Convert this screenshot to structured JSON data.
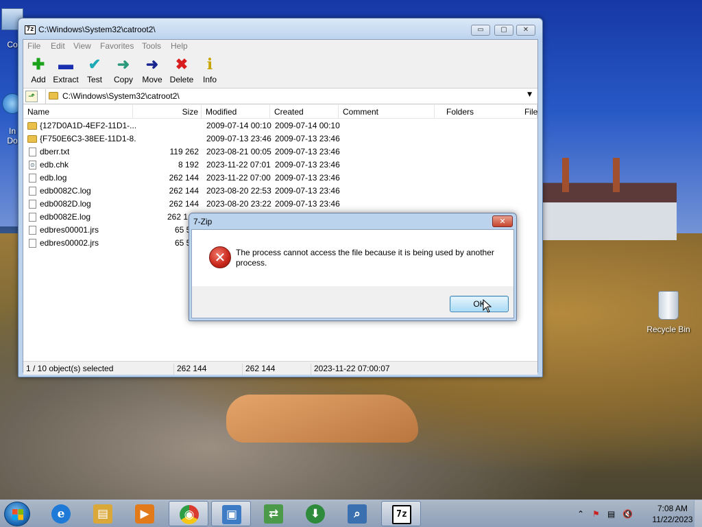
{
  "desktop": {
    "icons": [
      {
        "label": "Co",
        "icon": "computer-icon"
      },
      {
        "label": "In\nDo",
        "icon": "internet-explorer-icon"
      },
      {
        "label": "Recycle Bin",
        "icon": "recycle-bin-icon"
      }
    ]
  },
  "window": {
    "title": "C:\\Windows\\System32\\catroot2\\",
    "app_icon_label": "7z",
    "caption_buttons": {
      "minimize": "▭",
      "maximize": "▢",
      "close": "✕"
    },
    "menu": [
      "File",
      "Edit",
      "View",
      "Favorites",
      "Tools",
      "Help"
    ],
    "toolbar": [
      {
        "label": "Add",
        "icon": "add-plus-icon",
        "glyph": "✚",
        "color": "#1aa31a"
      },
      {
        "label": "Extract",
        "icon": "extract-minus-icon",
        "glyph": "▬",
        "color": "#1a2fb0"
      },
      {
        "label": "Test",
        "icon": "test-checkmark-icon",
        "glyph": "✔",
        "color": "#1ba9b5"
      },
      {
        "label": "Copy",
        "icon": "copy-arrow-icon",
        "glyph": "➜",
        "color": "#2a9a7a"
      },
      {
        "label": "Move",
        "icon": "move-arrow-icon",
        "glyph": "➜",
        "color": "#1a2690"
      },
      {
        "label": "Delete",
        "icon": "delete-x-icon",
        "glyph": "✖",
        "color": "#d81e1e"
      },
      {
        "label": "Info",
        "icon": "info-icon",
        "glyph": "i",
        "color": "#c8a400"
      }
    ],
    "address": "C:\\Windows\\System32\\catroot2\\",
    "columns": [
      "Name",
      "Size",
      "Modified",
      "Created",
      "Comment",
      "Folders",
      "File"
    ],
    "rows": [
      {
        "name": "{127D0A1D-4EF2-11D1-...",
        "size": "",
        "modified": "2009-07-14 00:10",
        "created": "2009-07-14 00:10",
        "type": "folder"
      },
      {
        "name": "{F750E6C3-38EE-11D1-8...",
        "size": "",
        "modified": "2009-07-13 23:46",
        "created": "2009-07-13 23:46",
        "type": "folder"
      },
      {
        "name": "dberr.txt",
        "size": "119 262",
        "modified": "2023-08-21 00:05",
        "created": "2009-07-13 23:46",
        "type": "file"
      },
      {
        "name": "edb.chk",
        "size": "8 192",
        "modified": "2023-11-22 07:01",
        "created": "2009-07-13 23:46",
        "type": "chk"
      },
      {
        "name": "edb.log",
        "size": "262 144",
        "modified": "2023-11-22 07:00",
        "created": "2009-07-13 23:46",
        "type": "file"
      },
      {
        "name": "edb0082C.log",
        "size": "262 144",
        "modified": "2023-08-20 22:53",
        "created": "2009-07-13 23:46",
        "type": "file"
      },
      {
        "name": "edb0082D.log",
        "size": "262 144",
        "modified": "2023-08-20 23:22",
        "created": "2009-07-13 23:46",
        "type": "file"
      },
      {
        "name": "edb0082E.log",
        "size": "262 1",
        "modified": "",
        "created": "",
        "type": "file"
      },
      {
        "name": "edbres00001.jrs",
        "size": "65 5",
        "modified": "",
        "created": "",
        "type": "file"
      },
      {
        "name": "edbres00002.jrs",
        "size": "65 5",
        "modified": "",
        "created": "",
        "type": "file"
      }
    ],
    "status": {
      "selection": "1 / 10 object(s) selected",
      "size": "262 144",
      "packed": "262 144",
      "date": "2023-11-22 07:00:07"
    },
    "scroll_grip": "|||"
  },
  "dialog": {
    "title": "7-Zip",
    "close_glyph": "✕",
    "error_glyph": "✕",
    "message": "The process cannot access the file because it is being used by another process.",
    "ok_label": "OK"
  },
  "taskbar": {
    "apps": [
      {
        "name": "internet-explorer",
        "glyph": "e",
        "color": "#1e7ad6",
        "active": false
      },
      {
        "name": "file-explorer",
        "glyph": "▤",
        "color": "#d9a838",
        "active": false
      },
      {
        "name": "media-player",
        "glyph": "▶",
        "color": "#e27a1a",
        "active": false
      },
      {
        "name": "chrome",
        "glyph": "◉",
        "color": "#d93b2f",
        "active": true
      },
      {
        "name": "remote-desktop",
        "glyph": "▣",
        "color": "#3d7bc4",
        "active": true
      },
      {
        "name": "network-tool",
        "glyph": "⇄",
        "color": "#4a9a4a",
        "active": false
      },
      {
        "name": "download-manager",
        "glyph": "⬇",
        "color": "#2e8b3c",
        "active": false
      },
      {
        "name": "search-tool",
        "glyph": "⌕",
        "color": "#3a6fb0",
        "active": false
      },
      {
        "name": "7zip",
        "glyph": "7z",
        "color": "#222222",
        "active": true
      }
    ],
    "tray_icons": [
      "⌃",
      "⚑",
      "▤",
      "🔇"
    ],
    "time": "7:08 AM",
    "date": "11/22/2023"
  }
}
